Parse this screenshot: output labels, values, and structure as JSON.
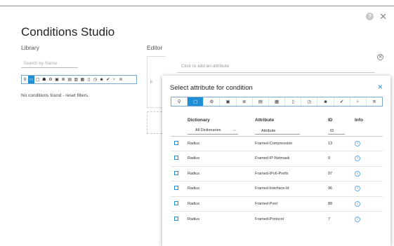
{
  "window": {
    "title": "Conditions Studio"
  },
  "library": {
    "label": "Library",
    "search_placeholder": "Search by Name",
    "icons": [
      "pin-icon",
      "card-icon",
      "square-icon",
      "users-icon",
      "gear-circle-icon",
      "monitor-icon",
      "list-icon",
      "screen-icon",
      "id-icon",
      "doc-icon",
      "device-icon",
      "clock-icon",
      "user-icon",
      "check-icon",
      "hierarchy-icon",
      "wifi-icon"
    ],
    "empty_message": "No conditions found - reset filters."
  },
  "editor": {
    "label": "Editor",
    "add_attribute_placeholder": "Click to add an attribute"
  },
  "popup": {
    "title": "Select attribute for condition",
    "icons": [
      "pin-icon",
      "square-icon",
      "gear-circle-icon",
      "monitor-icon",
      "list-icon",
      "screen-icon",
      "doc-icon",
      "device-icon",
      "clock-icon",
      "user-icon",
      "check-icon",
      "hierarchy-icon",
      "wifi-icon"
    ],
    "columns": [
      "Dictionary",
      "Attribute",
      "ID",
      "Info"
    ],
    "filters": {
      "dictionary": "All Dictionaries",
      "attribute": "Attribute",
      "id": "ID"
    },
    "rows": [
      {
        "dictionary": "Radius",
        "attribute": "Framed-Compression",
        "id": "13"
      },
      {
        "dictionary": "Radius",
        "attribute": "Framed-IP-Netmask",
        "id": "9"
      },
      {
        "dictionary": "Radius",
        "attribute": "Framed-IPv6-Prefix",
        "id": "97"
      },
      {
        "dictionary": "Radius",
        "attribute": "Framed-Interface-Id",
        "id": "96"
      },
      {
        "dictionary": "Radius",
        "attribute": "Framed-Pool",
        "id": "88"
      },
      {
        "dictionary": "Radius",
        "attribute": "Framed-Protocol",
        "id": "7"
      }
    ]
  },
  "colors": {
    "accent": "#1e8fd6",
    "border": "#7aa7c9"
  }
}
